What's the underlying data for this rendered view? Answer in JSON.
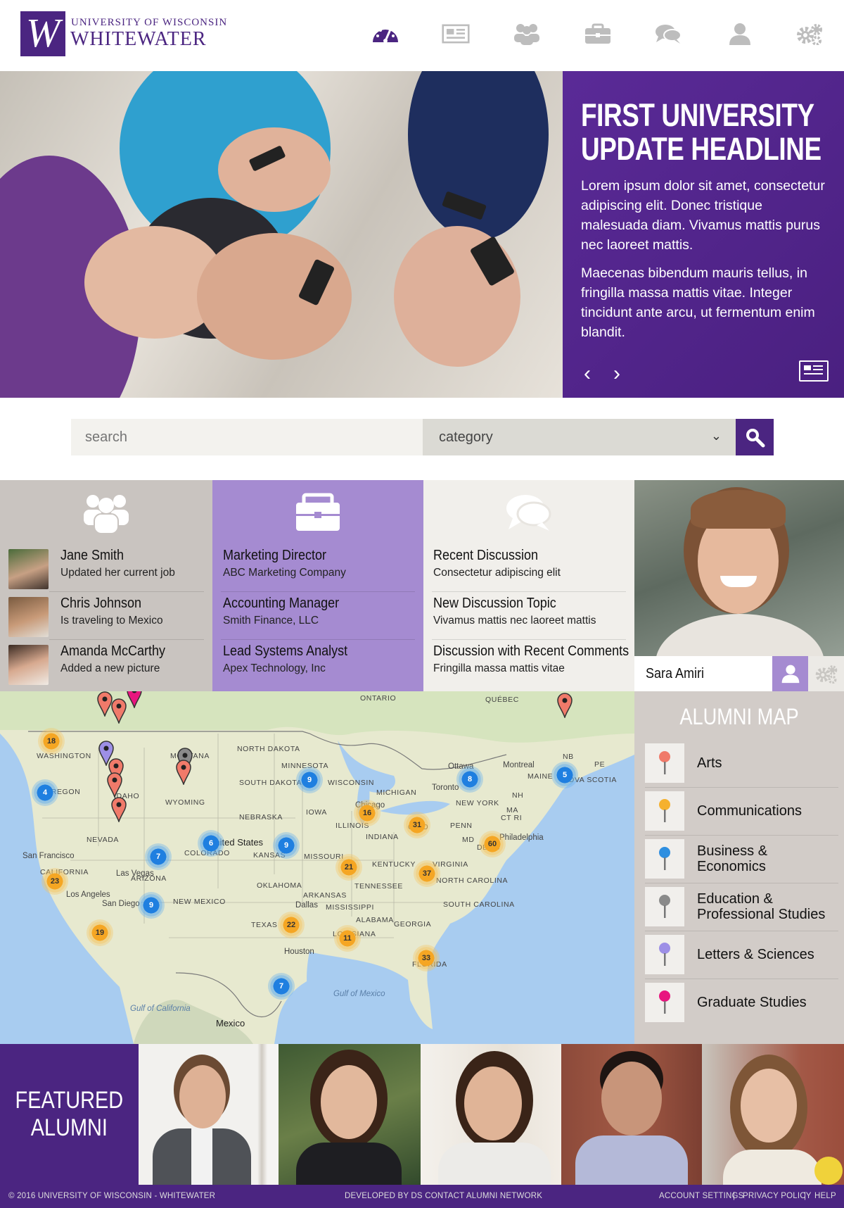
{
  "brand": {
    "line1": "UNIVERSITY OF WISCONSIN",
    "line2": "WHITEWATER",
    "mark": "W",
    "color": "#4b2581"
  },
  "nav": [
    {
      "icon": "dashboard-icon",
      "active": true
    },
    {
      "icon": "news-icon"
    },
    {
      "icon": "people-icon"
    },
    {
      "icon": "briefcase-icon"
    },
    {
      "icon": "chat-icon"
    },
    {
      "icon": "user-icon"
    },
    {
      "icon": "gear-icon"
    }
  ],
  "hero": {
    "title_line1": "FIRST UNIVERSITY",
    "title_line2": "UPDATE HEADLINE",
    "p1": "Lorem ipsum dolor sit amet, consectetur adipiscing elit. Donec tristique malesuada diam. Vivamus mattis purus nec laoreet mattis.",
    "p2": "Maecenas bibendum mauris tellus, in fringilla massa mattis vitae. Integer tincidunt ante arcu, ut fermentum enim blandit.",
    "prev": "‹",
    "next": "›"
  },
  "search": {
    "placeholder": "search",
    "category": "category"
  },
  "activity": [
    {
      "name": "Jane Smith",
      "text": "Updated her current job"
    },
    {
      "name": "Chris Johnson",
      "text": "Is traveling to Mexico"
    },
    {
      "name": "Amanda McCarthy",
      "text": "Added a new picture"
    }
  ],
  "jobs": [
    {
      "title": "Marketing Director",
      "company": "ABC Marketing Company"
    },
    {
      "title": "Accounting Manager",
      "company": "Smith Finance, LLC"
    },
    {
      "title": "Lead Systems Analyst",
      "company": "Apex Technology, Inc"
    }
  ],
  "discussions": [
    {
      "title": "Recent Discussion",
      "text": "Consectetur adipiscing elit"
    },
    {
      "title": "New Discussion Topic",
      "text": "Vivamus mattis nec laoreet mattis"
    },
    {
      "title": "Discussion with Recent Comments",
      "text": "Fringilla massa mattis vitae"
    }
  ],
  "profile": {
    "name": "Sara Amiri"
  },
  "map": {
    "labels": [
      "ONTARIO",
      "QUÉBEC",
      "NORTH DAKOTA",
      "MINNESOTA",
      "WASHINGTON",
      "MONTANA",
      "SOUTH DAKOTA",
      "WISCONSIN",
      "MICHIGAN",
      "Ottawa",
      "Montreal",
      "PE",
      "NB",
      "MAINE",
      "NOVA SCOTIA",
      "Toronto",
      "NEW YORK",
      "OREGON",
      "IDAHO",
      "WYOMING",
      "NEBRASKA",
      "IOWA",
      "ILLINOIS",
      "Chicago",
      "OHIO",
      "PENN",
      "NH",
      "MA",
      "CT RI",
      "Philadelphia",
      "MD",
      "DE NJ",
      "NEVADA",
      "United States",
      "COLORADO",
      "KANSAS",
      "MISSOURI",
      "INDIANA",
      "KENTUCKY",
      "VIRGINIA",
      "San Francisco",
      "CALIFORNIA",
      "Las Vegas",
      "Los Angeles",
      "San Diego",
      "ARIZONA",
      "NEW MEXICO",
      "OKLAHOMA",
      "ARKANSAS",
      "TENNESSEE",
      "NORTH CAROLINA",
      "SOUTH CAROLINA",
      "MISSISSIPPI",
      "ALABAMA",
      "GEORGIA",
      "Dallas",
      "TEXAS",
      "LOUISIANA",
      "Houston",
      "FLORIDA",
      "Gulf of Mexico",
      "Gulf of California",
      "Mexico"
    ],
    "clusters": [
      {
        "n": "18",
        "c": "orange"
      },
      {
        "n": "4",
        "c": "blue"
      },
      {
        "n": "9",
        "c": "blue"
      },
      {
        "n": "8",
        "c": "blue"
      },
      {
        "n": "5",
        "c": "blue"
      },
      {
        "n": "16",
        "c": "orange"
      },
      {
        "n": "31",
        "c": "orange"
      },
      {
        "n": "60",
        "c": "orange"
      },
      {
        "n": "6",
        "c": "blue"
      },
      {
        "n": "9",
        "c": "blue"
      },
      {
        "n": "7",
        "c": "blue"
      },
      {
        "n": "21",
        "c": "orange"
      },
      {
        "n": "37",
        "c": "orange"
      },
      {
        "n": "23",
        "c": "orange"
      },
      {
        "n": "9",
        "c": "blue"
      },
      {
        "n": "19",
        "c": "orange"
      },
      {
        "n": "22",
        "c": "orange"
      },
      {
        "n": "11",
        "c": "orange"
      },
      {
        "n": "33",
        "c": "orange"
      },
      {
        "n": "7",
        "c": "blue"
      }
    ]
  },
  "legend": {
    "title": "ALUMNI MAP",
    "items": [
      {
        "label": "Arts",
        "color": "#f07a6a"
      },
      {
        "label": "Communications",
        "color": "#f5b12e"
      },
      {
        "label": "Business & Economics",
        "color": "#2f8fe0"
      },
      {
        "label": "Education & Professional Studies",
        "color": "#8a8a8a"
      },
      {
        "label": "Letters & Sciences",
        "color": "#9d8fe6"
      },
      {
        "label": "Graduate Studies",
        "color": "#e8157f"
      }
    ]
  },
  "featured": {
    "title_line1": "FEATURED",
    "title_line2": "ALUMNI"
  },
  "footer": {
    "copyright": "© 2016 UNIVERSITY OF WISCONSIN - WHITEWATER",
    "developer": "DEVELOPED BY DS CONTACT ALUMNI NETWORK",
    "links": [
      "ACCOUNT SETTINGS",
      "PRIVACY POLICY",
      "HELP"
    ]
  }
}
